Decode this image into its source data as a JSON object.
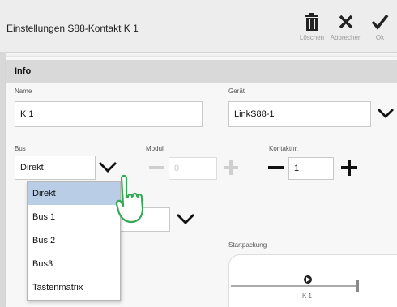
{
  "window": {
    "title": "Einstellungen S88-Kontakt K 1",
    "buttons": [
      {
        "label": "Löschen",
        "icon": "trash-icon"
      },
      {
        "label": "Abbrechen",
        "icon": "close-icon"
      },
      {
        "label": "Ok",
        "icon": "check-icon"
      }
    ]
  },
  "section": {
    "title": "Info"
  },
  "name": {
    "label": "Name",
    "value": "K 1"
  },
  "geraet": {
    "label": "Gerät",
    "value": "LinkS88-1"
  },
  "bus": {
    "label": "Bus",
    "value": "Direkt"
  },
  "modul": {
    "label": "Modul",
    "value": "0"
  },
  "kontakt": {
    "label": "Kontaktnr.",
    "value": "1"
  },
  "startpackung": {
    "label": "Startpackung",
    "preview_label": "K 1"
  },
  "bus_dropdown": {
    "options": [
      "Direkt",
      "Bus 1",
      "Bus 2",
      "Bus3",
      "Tastenmatrix"
    ],
    "selected": "Direkt"
  },
  "colors": {
    "selected": "#b9cde6",
    "header": "#d9d9d9"
  }
}
